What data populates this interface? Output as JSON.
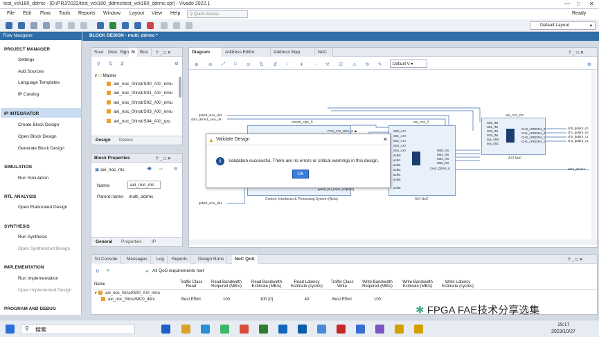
{
  "window": {
    "title": "test_vck180_ddrmc - [D:/PRJ/2022/test_vck180_ddrmc/test_vck180_ddrmc.xpr] - Vivado 2022.1",
    "status": "Ready"
  },
  "menu": [
    "File",
    "Edit",
    "Flow",
    "Tools",
    "Reports",
    "Window",
    "Layout",
    "View",
    "Help"
  ],
  "quick_access": {
    "placeholder": "Quick Access"
  },
  "layout_select": "Default Layout",
  "flow_nav": {
    "title": "Flow Navigator",
    "sections": [
      {
        "label": "PROJECT MANAGER",
        "items": [
          "Settings",
          "Add Sources",
          "Language Templates",
          "IP Catalog"
        ]
      },
      {
        "label": "IP INTEGRATOR",
        "items": [
          "Create Block Design",
          "Open Block Design",
          "Generate Block Design"
        ]
      },
      {
        "label": "SIMULATION",
        "items": [
          "Run Simulation"
        ]
      },
      {
        "label": "RTL ANALYSIS",
        "items": [
          "Open Elaborated Design"
        ]
      },
      {
        "label": "SYNTHESIS",
        "items": [
          "Run Synthesis",
          "Open Synthesized Design"
        ]
      },
      {
        "label": "IMPLEMENTATION",
        "items": [
          "Run Implementation",
          "Open Implemented Design"
        ]
      },
      {
        "label": "PROGRAM AND DEBUG",
        "items": []
      }
    ]
  },
  "block_design": {
    "title": "BLOCK DESIGN - multi_ddrmc *"
  },
  "sources": {
    "tabs": [
      "Sour",
      "Desi",
      "Sign",
      "N",
      "Boa"
    ],
    "root": "Master",
    "items": [
      "axi_noc_0/inst/S00_AXI_nmu",
      "axi_noc_0/inst/S01_AXI_nmu",
      "axi_noc_0/inst/S02_AXI_nmu",
      "axi_noc_0/inst/S03_AXI_nmu",
      "axi_noc_0/inst/S04_AXI_rpu"
    ],
    "bottom_tabs": [
      "Design",
      "Device"
    ]
  },
  "block_props": {
    "title": "Block Properties",
    "selected": "axi_noc_mc",
    "name_label": "Name:",
    "name_value": "axi_noc_mc",
    "parent_label": "Parent name:",
    "parent_value": "multi_ddrmc",
    "tabs": [
      "General",
      "Properties",
      "IP"
    ]
  },
  "diagram": {
    "tabs": [
      "Diagram",
      "Address Editor",
      "Address Map",
      "NoC"
    ],
    "view_select": "Default V",
    "blocks": {
      "cips": {
        "label": "versal_cips_0",
        "caption": "Control, Interfaces & Processing System (Beta)",
        "pins": [
          "FPD_CCI_NOC_0 -▶",
          "pmc_axi_noc_0",
          "gem0_tsu_timer_cnt[93:0]"
        ]
      },
      "noc": {
        "label": "axi_noc_0",
        "caption": "AXI NoC",
        "left_pins": [
          "S00_AXI",
          "S01_AXI",
          "S02_AXI",
          "S03_AXI",
          "S04_AXI",
          "aclk0",
          "aclk1",
          "aclk2",
          "aclk3",
          "aclk4",
          "aclk5",
          "aclk6"
        ],
        "right_pins": [
          "M00_INI",
          "M01_INI",
          "M02_INI",
          "M03_INI",
          "CH0_DDR4_0"
        ]
      },
      "mc": {
        "label": "axi_noc_mc",
        "caption": "AXI NoC",
        "left_pins": [
          "S00_INI",
          "S01_INI",
          "S02_INI",
          "S03_INI",
          "sys_clk0",
          "sys_clk1"
        ],
        "right_pins": [
          "CH0_LPDDR4_0",
          "CH1_LPDDR4_0",
          "CH0_LPDDR4_1",
          "CH1_LPDDR4_1"
        ]
      }
    },
    "ports_left": [
      "lpddr4_sms_clk2",
      "ddr4_dimm1_sms_clk",
      "lpddr4_sms_clk1"
    ],
    "ports_right": [
      "ch0_lpddr4_c0",
      "ch1_lpddr4_c0",
      "ch0_lpddr4_c1",
      "ch1_lpddr4_c1",
      "ddr4_dimm1"
    ]
  },
  "dialog": {
    "title": "Validate Design",
    "message": "Validation successful. There are no errors or critical warnings in this design.",
    "ok": "OK"
  },
  "bottom": {
    "tabs": [
      "Tcl Console",
      "Messages",
      "Log",
      "Reports",
      "Design Runs",
      "NoC QoS"
    ],
    "status": "All QoS requirements met",
    "headers": [
      "Name",
      "Traffic Class Read",
      "Read Bandwidth Required (MB/s)",
      "Read Bandwidth Estimate (MB/s)",
      "Read Latency Estimate (cycles)",
      "Traffic Class Write",
      "Write Bandwidth Required (MB/s)",
      "Write Bandwidth Estimate (MB/s)",
      "Write Latency Estimate (cycles)"
    ],
    "rows": [
      [
        "axi_noc_0/inst/S00_AXI_nmu",
        "",
        "",
        "",
        "",
        "",
        "",
        "",
        ""
      ],
      [
        "axi_noc_0/inst/MC0_ddrc",
        "Best Effort",
        "100",
        "100 (0)",
        "40",
        "Best Effort",
        "100",
        "",
        ""
      ]
    ]
  },
  "taskbar": {
    "search": "搜索",
    "time": "19:17",
    "date": "2023/10/27"
  },
  "watermark": "FPGA FAE技术分享选集"
}
